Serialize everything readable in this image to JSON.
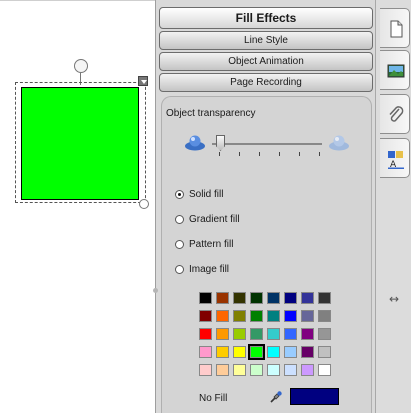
{
  "panel": {
    "title": "Fill Effects",
    "sections": [
      "Line Style",
      "Object Animation",
      "Page Recording"
    ],
    "transparency_label": "Object transparency",
    "transparency_value": 0.0,
    "fill_options": [
      {
        "label": "Solid fill",
        "selected": true
      },
      {
        "label": "Gradient fill",
        "selected": false
      },
      {
        "label": "Pattern fill",
        "selected": false
      },
      {
        "label": "Image fill",
        "selected": false
      }
    ],
    "no_fill_label": "No Fill",
    "current_color": "#000080",
    "palette": [
      [
        "#000000",
        "#993300",
        "#333300",
        "#003300",
        "#003366",
        "#000080",
        "#333399",
        "#333333"
      ],
      [
        "#800000",
        "#ff6600",
        "#808000",
        "#008000",
        "#008080",
        "#0000ff",
        "#666699",
        "#808080"
      ],
      [
        "#ff0000",
        "#ff9900",
        "#99cc00",
        "#339966",
        "#33cccc",
        "#3366ff",
        "#800080",
        "#969696"
      ],
      [
        "#ff99cc",
        "#ffcc00",
        "#ffff00",
        "#00ff00",
        "#00ffff",
        "#99ccff",
        "#660066",
        "#c0c0c0"
      ],
      [
        "#ffcccc",
        "#ffcc99",
        "#ffff99",
        "#ccffcc",
        "#ccffff",
        "#cce0ff",
        "#cc99ff",
        "#ffffff"
      ]
    ],
    "selected_swatch": "#00ff00"
  },
  "canvas": {
    "shape_fill": "#00ff00"
  },
  "tabs": [
    {
      "icon": "page-sorter-icon"
    },
    {
      "icon": "gallery-icon"
    },
    {
      "icon": "attachments-icon"
    },
    {
      "icon": "properties-icon"
    }
  ]
}
